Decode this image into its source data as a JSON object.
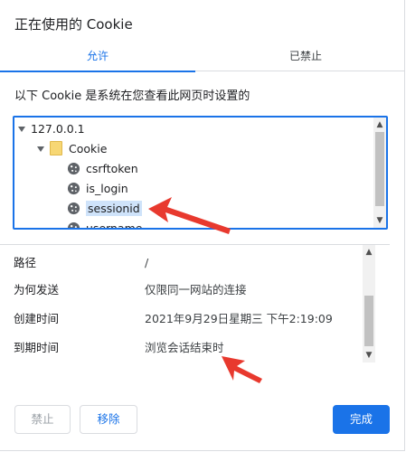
{
  "dialog": {
    "title": "正在使用的 Cookie"
  },
  "tabs": [
    {
      "label": "允许",
      "active": true
    },
    {
      "label": "已禁止",
      "active": false
    }
  ],
  "description": "以下 Cookie 是系统在您查看此网页时设置的",
  "tree": {
    "site": "127.0.0.1",
    "folder": "Cookie",
    "cookies": [
      "csrftoken",
      "is_login",
      "sessionid",
      "username"
    ],
    "selected": "sessionid"
  },
  "details": [
    {
      "label": "路径",
      "value": "/"
    },
    {
      "label": "为何发送",
      "value": "仅限同一网站的连接"
    },
    {
      "label": "创建时间",
      "value": "2021年9月29日星期三 下午2:19:09"
    },
    {
      "label": "到期时间",
      "value": "浏览会话结束时"
    }
  ],
  "buttons": {
    "block": "禁止",
    "remove": "移除",
    "done": "完成"
  },
  "colors": {
    "accent": "#1a73e8",
    "annotation": "#e8392e"
  }
}
